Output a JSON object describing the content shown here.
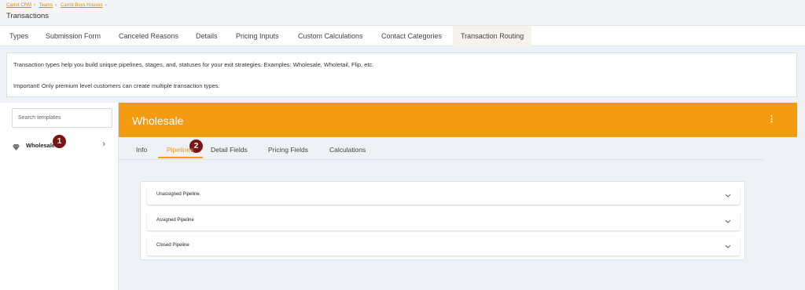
{
  "breadcrumbs": [
    "Carrot CRM",
    "Teams",
    "Carrot Buys Houses"
  ],
  "page_title": "Transactions",
  "tabs": [
    "Types",
    "Submission Form",
    "Canceled Reasons",
    "Details",
    "Pricing Inputs",
    "Custom Calculations",
    "Contact Categories",
    "Transaction Routing"
  ],
  "active_tab": "Transaction Routing",
  "info": {
    "line1": "Transaction types help you build unique pipelines, stages, and, statuses for your exit strategies. Examples: Wholesale, Wholetail, Flip, etc.",
    "line2": "Important! Only premium level customers can create multiple transaction types."
  },
  "sidebar": {
    "search_placeholder": "Search templates",
    "items": [
      {
        "label": "Wholesale",
        "icon": "diamond-icon"
      }
    ]
  },
  "panel": {
    "title": "Wholesale",
    "header_color": "#f39c12",
    "subtabs": [
      "Info",
      "Pipelines",
      "Detail Fields",
      "Pricing Fields",
      "Calculations"
    ],
    "active_subtab": "Pipelines",
    "pipelines": [
      "Unassigned Pipeline",
      "Assigned Pipeline",
      "Closed Pipeline"
    ]
  },
  "annotations": [
    "1",
    "2"
  ],
  "colors": {
    "accent": "#f39c12",
    "link": "#e08a00",
    "badge": "#7a1515"
  }
}
